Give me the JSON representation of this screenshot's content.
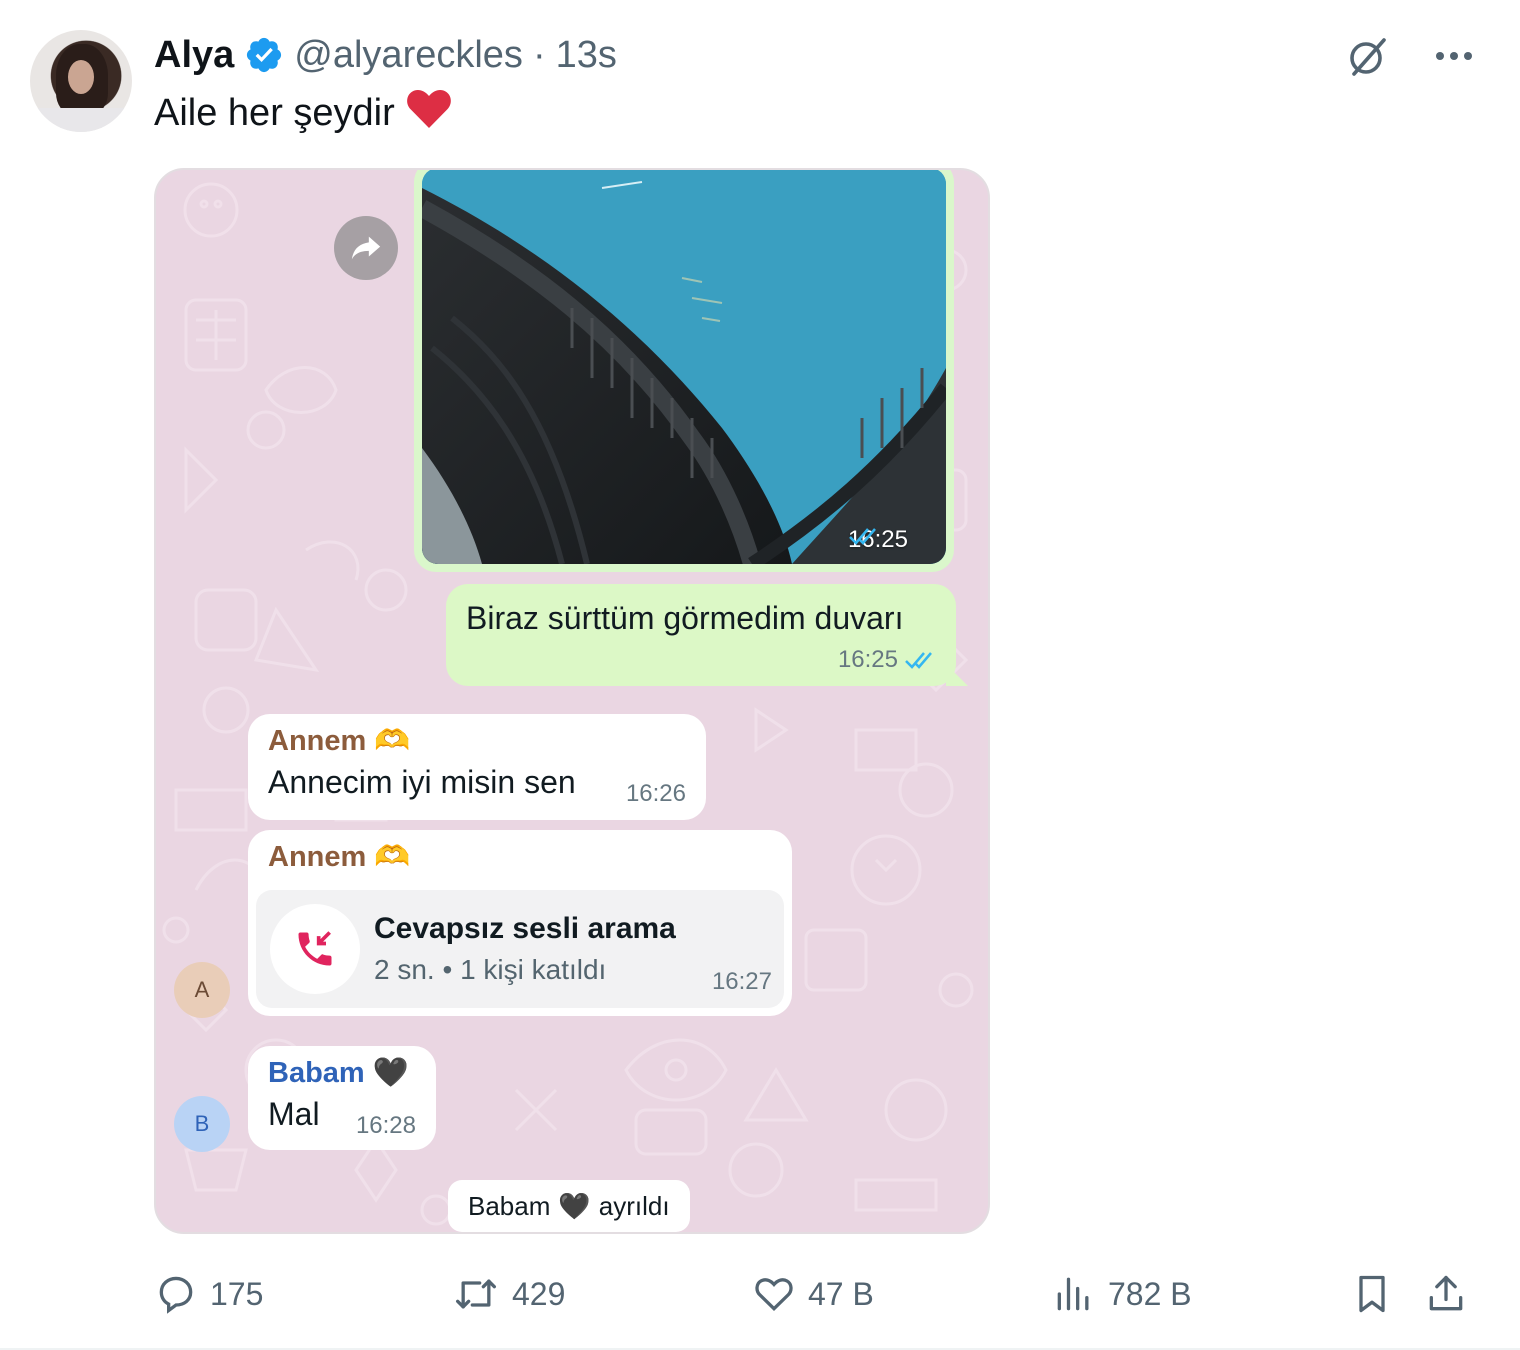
{
  "tweet": {
    "author_name": "Alya",
    "handle": "@alyareckles",
    "separator": "·",
    "time_ago": "13s",
    "text": "Aile her şeydir",
    "text_emoji": "❤️"
  },
  "chat": {
    "image_message": {
      "time": "16:25"
    },
    "outgoing": {
      "text": "Biraz sürttüm görmedim duvarı",
      "time": "16:25"
    },
    "msg1": {
      "sender": "Annem",
      "sender_emoji": "🫶",
      "text": "Annecim iyi misin sen",
      "time": "16:26"
    },
    "msg2": {
      "sender": "Annem",
      "sender_emoji": "🫶",
      "call_title": "Cevapsız sesli arama",
      "call_detail": "2 sn. • 1 kişi katıldı",
      "time": "16:27"
    },
    "msg3": {
      "sender": "Babam",
      "sender_emoji": "🖤",
      "text": "Mal",
      "time": "16:28"
    },
    "avatar_a": "A",
    "avatar_b": "B",
    "system": {
      "name": "Babam",
      "emoji": "🖤",
      "text": "ayrıldı"
    }
  },
  "actions": {
    "replies": "175",
    "reposts": "429",
    "likes": "47 B",
    "views": "782 B"
  },
  "colors": {
    "verified": "#1d9bf0",
    "outgoing_bubble": "#dcf8c6",
    "chat_bg": "#ead6e2",
    "missed_call": "#e0245e",
    "read_ticks": "#34b7f1"
  }
}
